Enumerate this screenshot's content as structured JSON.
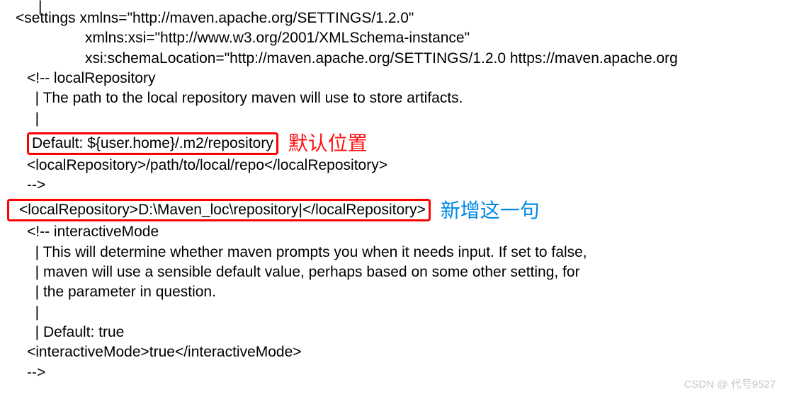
{
  "cursor": "|",
  "lines": {
    "settings_open": "<settings xmlns=\"http://maven.apache.org/SETTINGS/1.2.0\"",
    "xmlns_xsi": "xmlns:xsi=\"http://www.w3.org/2001/XMLSchema-instance\"",
    "xsi_location": "xsi:schemaLocation=\"http://maven.apache.org/SETTINGS/1.2.0 https://maven.apache.org",
    "comment_localrepo": "<!-- localRepository",
    "localrepo_desc": "  | The path to the local repository maven will use to store artifacts.",
    "pipe_blank": "  |",
    "default_repo": "Default: ${user.home}/.m2/repository",
    "localrepo_example": "<localRepository>/path/to/local/repo</localRepository>",
    "comment_close": "-->",
    "localrepo_new": "<localRepository>D:\\Maven_loc\\repository|</localRepository>",
    "comment_interactive": "<!-- interactiveMode",
    "interactive_desc1": "  | This will determine whether maven prompts you when it needs input. If set to false,",
    "interactive_desc2": "  | maven will use a sensible default value, perhaps based on some other setting, for",
    "interactive_desc3": "  | the parameter in question.",
    "pipe_blank2": "  |",
    "default_true": "  | Default: true",
    "interactive_mode": "<interactiveMode>true</interactiveMode>",
    "comment_close2": "-->"
  },
  "annotations": {
    "default_position": "默认位置",
    "new_added_line": "新增这一句"
  },
  "watermark": "CSDN @ 代号9527"
}
